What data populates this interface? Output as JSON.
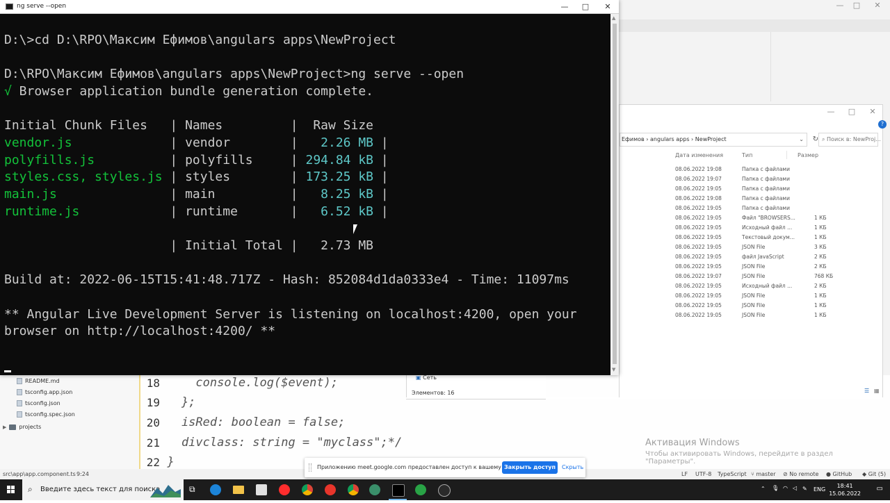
{
  "terminal": {
    "title": "ng serve --open",
    "lines": [
      {
        "parts": [
          {
            "t": "D:\\>cd D:\\RPO\\Максим Ефимов\\angulars apps\\NewProject",
            "c": ""
          }
        ]
      },
      {
        "parts": [
          {
            "t": "D:\\RPO\\Максим Ефимов\\angulars apps\\NewProject>ng serve --open",
            "c": ""
          }
        ]
      },
      {
        "parts": [
          {
            "t": "√",
            "c": "g"
          },
          {
            "t": " Browser application bundle generation complete.",
            "c": ""
          }
        ]
      },
      {
        "parts": [
          {
            "t": "Initial Chunk Files   | Names         |  Raw Size",
            "c": ""
          }
        ]
      },
      {
        "parts": [
          {
            "t": "vendor.js",
            "c": "g"
          },
          {
            "t": "             | vendor        |  ",
            "c": ""
          },
          {
            "t": " 2.26 MB",
            "c": "c"
          },
          {
            "t": " |",
            "c": ""
          }
        ]
      },
      {
        "parts": [
          {
            "t": "polyfills.js",
            "c": "g"
          },
          {
            "t": "          | polyfills     | ",
            "c": ""
          },
          {
            "t": "294.84 kB",
            "c": "c"
          },
          {
            "t": " |",
            "c": ""
          }
        ]
      },
      {
        "parts": [
          {
            "t": "styles.css, styles.js",
            "c": "g"
          },
          {
            "t": " | styles        | ",
            "c": ""
          },
          {
            "t": "173.25 kB",
            "c": "c"
          },
          {
            "t": " |",
            "c": ""
          }
        ]
      },
      {
        "parts": [
          {
            "t": "main.js",
            "c": "g"
          },
          {
            "t": "               | main          |  ",
            "c": ""
          },
          {
            "t": " 8.25 kB",
            "c": "c"
          },
          {
            "t": " |",
            "c": ""
          }
        ]
      },
      {
        "parts": [
          {
            "t": "runtime.js",
            "c": "g"
          },
          {
            "t": "            | runtime       |  ",
            "c": ""
          },
          {
            "t": " 6.52 kB",
            "c": "c"
          },
          {
            "t": " |",
            "c": ""
          }
        ]
      },
      {
        "parts": [
          {
            "t": "                      | Initial Total |   2.73 MB",
            "c": ""
          }
        ]
      },
      {
        "parts": [
          {
            "t": "Build at: 2022-06-15T15:41:48.717Z - Hash: 852084d1da0333e4 - Time: 11097ms",
            "c": ""
          }
        ]
      },
      {
        "parts": [
          {
            "t": "** Angular Live Development Server is listening on localhost:4200, open your",
            "c": ""
          }
        ]
      },
      {
        "parts": [
          {
            "t": "browser on http://localhost:4200/ **",
            "c": ""
          }
        ]
      }
    ]
  },
  "tree": {
    "items": [
      {
        "label": "README.md",
        "kind": "file"
      },
      {
        "label": "tsconfig.app.json",
        "kind": "file"
      },
      {
        "label": "tsconfig.json",
        "kind": "file"
      },
      {
        "label": "tsconfig.spec.json",
        "kind": "file"
      },
      {
        "label": "projects",
        "kind": "folder"
      }
    ]
  },
  "editor": {
    "lines": [
      {
        "num": "18",
        "code": "      console.log($event);"
      },
      {
        "num": "19",
        "code": "    };"
      },
      {
        "num": "20",
        "code": "    isRed: boolean = false;"
      },
      {
        "num": "21",
        "code": "    divclass: string = \"myclass\";*/"
      },
      {
        "num": "22",
        "code": "  }"
      }
    ]
  },
  "activation": {
    "title": "Активация Windows",
    "subtitle": "Чтобы активировать Windows, перейдите в раздел \"Параметры\"."
  },
  "ide_status": {
    "path": "src\\app\\app.component.ts",
    "pos": "9:24",
    "eol": "LF",
    "encoding": "UTF-8",
    "lang": "TypeScript",
    "branch": "master",
    "remote": "No remote",
    "github": "GitHub",
    "git": "Git (5)"
  },
  "explorer": {
    "address": "Ефимов  ›  angulars apps  ›  NewProject",
    "search_placeholder": "Поиск в: NewProj...",
    "columns": {
      "date": "Дата изменения",
      "type": "Тип",
      "size": "Размер"
    },
    "rows": [
      {
        "date": "08.06.2022 19:08",
        "type": "Папка с файлами",
        "size": ""
      },
      {
        "date": "08.06.2022 19:07",
        "type": "Папка с файлами",
        "size": ""
      },
      {
        "date": "08.06.2022 19:05",
        "type": "Папка с файлами",
        "size": ""
      },
      {
        "date": "08.06.2022 19:08",
        "type": "Папка с файлами",
        "size": ""
      },
      {
        "date": "08.06.2022 19:05",
        "type": "Папка с файлами",
        "size": ""
      },
      {
        "date": "08.06.2022 19:05",
        "type": "Файл \"BROWSERS...",
        "size": "1 КБ"
      },
      {
        "date": "08.06.2022 19:05",
        "type": "Исходный файл ...",
        "size": "1 КБ"
      },
      {
        "date": "08.06.2022 19:05",
        "type": "Текстовый докум...",
        "size": "1 КБ"
      },
      {
        "date": "08.06.2022 19:05",
        "type": "JSON File",
        "size": "3 КБ"
      },
      {
        "date": "08.06.2022 19:05",
        "type": "файл JavaScript",
        "size": "2 КБ"
      },
      {
        "date": "08.06.2022 19:05",
        "type": "JSON File",
        "size": "2 КБ"
      },
      {
        "date": "08.06.2022 19:07",
        "type": "JSON File",
        "size": "768 КБ"
      },
      {
        "date": "08.06.2022 19:05",
        "type": "Исходный файл ...",
        "size": "2 КБ"
      },
      {
        "date": "08.06.2022 19:05",
        "type": "JSON File",
        "size": "1 КБ"
      },
      {
        "date": "08.06.2022 19:05",
        "type": "JSON File",
        "size": "1 КБ"
      },
      {
        "date": "08.06.2022 19:05",
        "type": "JSON File",
        "size": "1 КБ"
      }
    ],
    "nav_network": "Сеть",
    "status": "Элементов: 16"
  },
  "share_bar": {
    "text": "Приложению meet.google.com предоставлен доступ к вашему экрану.",
    "stop_label": "Закрыть доступ",
    "hide_label": "Скрыть"
  },
  "taskbar": {
    "search_placeholder": "Введите здесь текст для поиска",
    "lang": "ENG",
    "time": "18:41",
    "date": "15.06.2022"
  },
  "colors": {
    "terminal_bg": "#0c0c0c",
    "terminal_text": "#cccccc",
    "terminal_green": "#13c23a",
    "terminal_cyan": "#5ec8c8",
    "share_button": "#1a73e8",
    "taskbar_bg": "#1c1c1c"
  }
}
